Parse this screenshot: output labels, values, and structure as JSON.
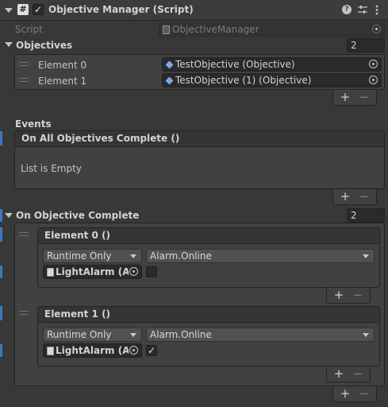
{
  "header": {
    "title": "Objective Manager (Script)",
    "enabled": true,
    "icons": [
      "script-hash-icon",
      "help-icon",
      "preset-icon",
      "more-icon"
    ]
  },
  "script_field": {
    "label": "Script",
    "value": "ObjectiveManager"
  },
  "objectives": {
    "label": "Objectives",
    "size": "2",
    "items": [
      {
        "label": "Element 0",
        "value": "TestObjective (Objective)"
      },
      {
        "label": "Element 1",
        "value": "TestObjective (1) (Objective)"
      }
    ]
  },
  "events": {
    "label": "Events",
    "all_complete": {
      "title": "On All Objectives Complete ()",
      "empty_text": "List is Empty"
    }
  },
  "on_objective_complete": {
    "label": "On Objective Complete",
    "size": "2",
    "elements": [
      {
        "title": "Element 0 ()",
        "mode": "Runtime Only",
        "function": "Alarm.Online",
        "target": "LightAlarm (Ala",
        "checked": false
      },
      {
        "title": "Element 1 ()",
        "mode": "Runtime Only",
        "function": "Alarm.Online",
        "target": "LightAlarm (Ala",
        "checked": true
      }
    ]
  },
  "buttons": {
    "plus": "+",
    "minus": "−",
    "check": "✓"
  },
  "colors": {
    "accent_bar": "#3a79bb",
    "background": "#383838"
  }
}
